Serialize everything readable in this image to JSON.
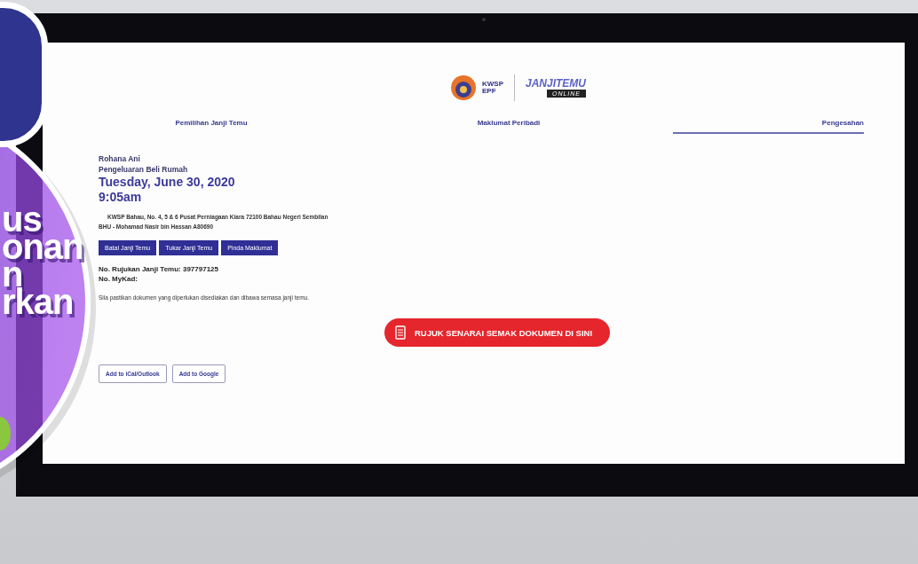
{
  "overlay": {
    "lines": [
      "us",
      "onan",
      "n",
      "rkan"
    ]
  },
  "logo": {
    "kwsp": "KWSP",
    "epf": "EPF",
    "title": "**JANJI**TEMU",
    "subtitle": "ONLINE"
  },
  "tabs": [
    {
      "label": "Pemilihan Janji Temu",
      "selected": false
    },
    {
      "label": "Maklumat Peribadi",
      "selected": false
    },
    {
      "label": "Pengesahan",
      "selected": true
    }
  ],
  "appointment": {
    "name": "Rohana Ani",
    "service": "Pengeluaran Beli Rumah",
    "date": "Tuesday, June 30, 2020",
    "time": "9:05am",
    "address": "KWSP Bahau, No. 4, 5 & 6 Pusat Perniagaan Kiara 72100 Bahau Negeri Sembilan",
    "officer": "BHU - Mohamad Nasir bin Hassan A80690"
  },
  "actions": [
    "Batal Janji Temu",
    "Tukar Janji Temu",
    "Pinda Maklumat"
  ],
  "reference": "No. Rujukan Janji Temu: 397797125",
  "mykad": "No. MyKad:",
  "notice": "Sila pastikan dokumen yang diperlukan disediakan dan dibawa semasa janji temu.",
  "checklist_button": "RUJUK SENARAI SEMAK DOKUMEN DI SINI",
  "calendar_buttons": [
    "Add to iCal/Outlook",
    "Add to Google"
  ]
}
